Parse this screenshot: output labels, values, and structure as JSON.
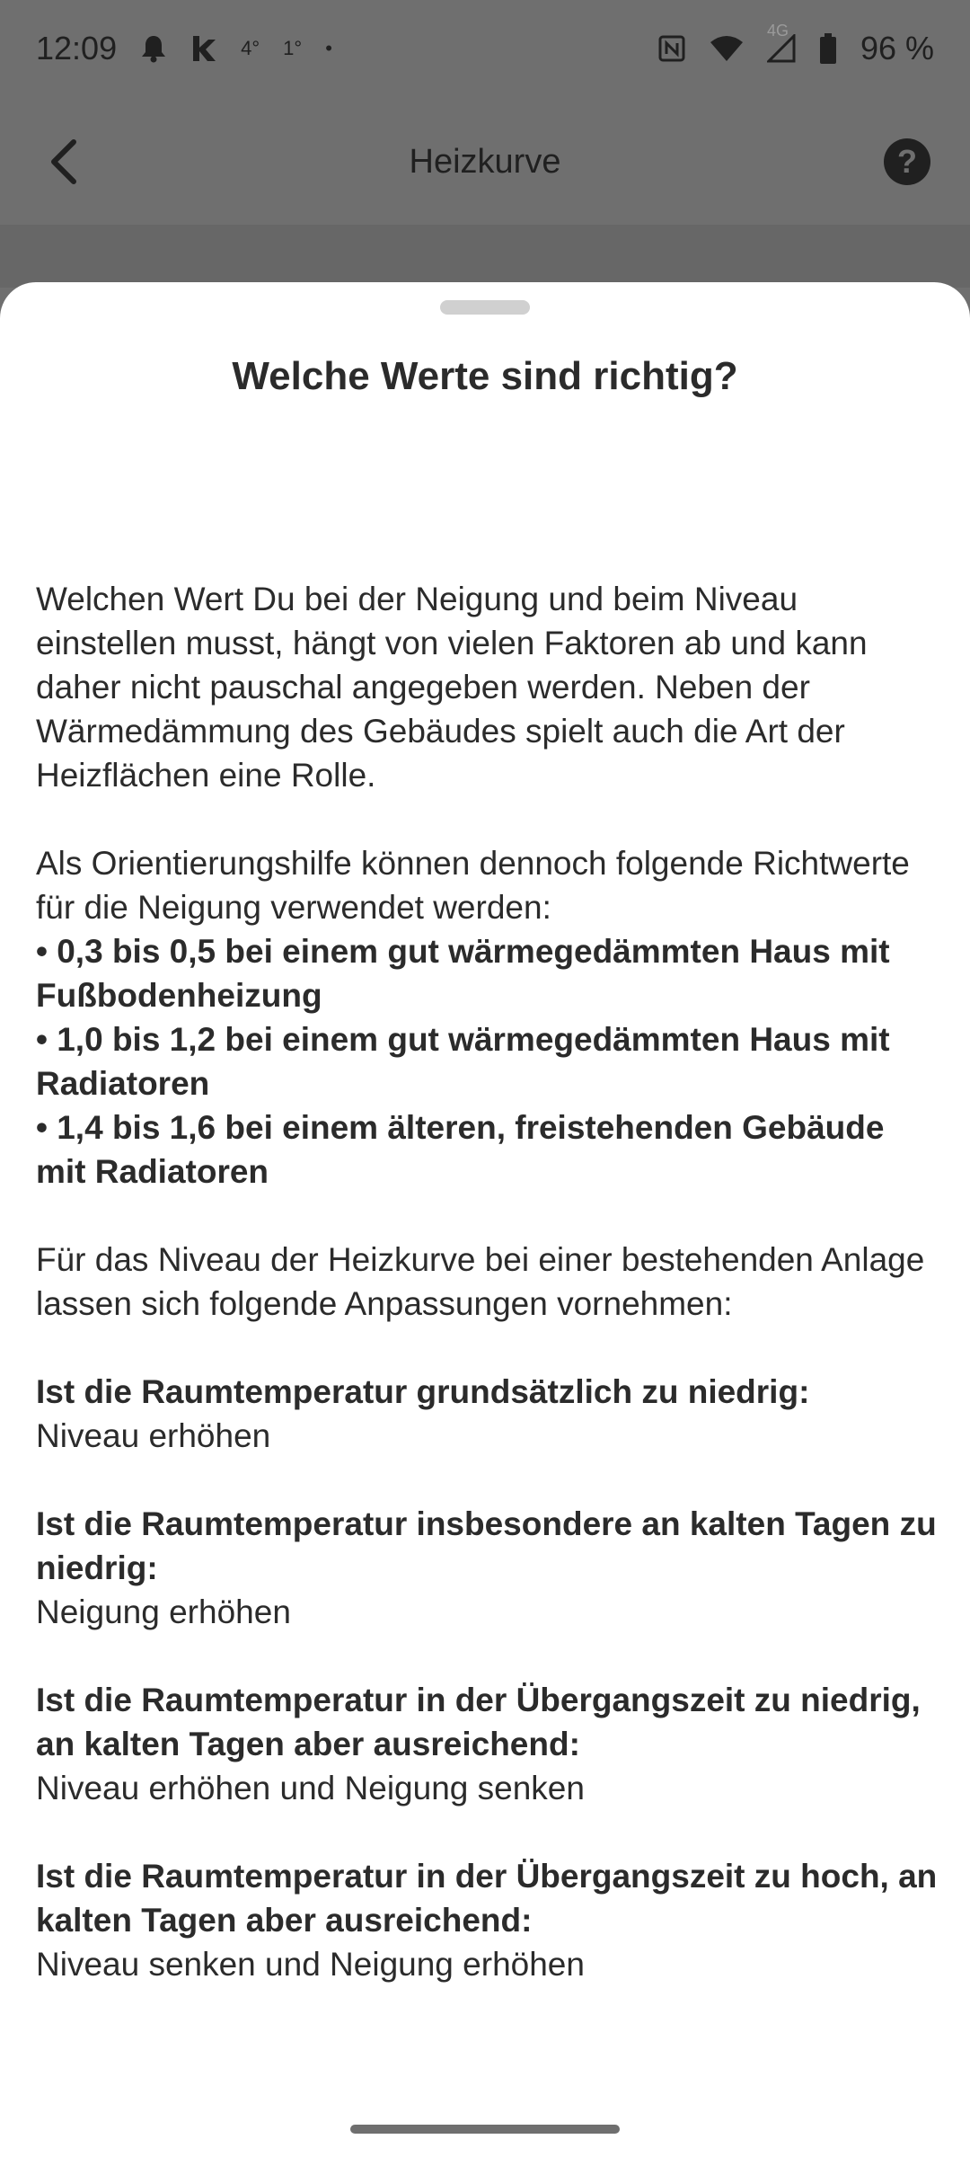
{
  "status_bar": {
    "time": "12:09",
    "temp1": "4°",
    "temp2": "1°",
    "dot": "•",
    "network": "4G",
    "battery": "96 %",
    "icons": [
      "bell-icon",
      "k-app-icon",
      "nfc-icon",
      "wifi-icon",
      "signal-icon",
      "battery-icon"
    ]
  },
  "app_bar": {
    "title": "Heizkurve",
    "back_icon": "chevron-left-icon",
    "help_icon": "help-circle-icon"
  },
  "sheet": {
    "title": "Welche Werte sind richtig?",
    "intro": "Welchen Wert Du bei der Neigung und beim Niveau einstellen musst, hängt von vielen Faktoren ab und kann daher nicht pauschal angegeben werden. Neben der Wärmedämmung des Gebäudes spielt auch die Art der Heizflächen eine Rolle.",
    "guide_intro": "Als Orientierungshilfe können dennoch folgende Richtwerte für die Neigung verwendet werden:",
    "bullets": [
      "• 0,3 bis 0,5 bei einem gut wärmegedämmten Haus mit Fußbodenheizung",
      "• 1,0 bis 1,2 bei einem gut wärmegedämmten Haus mit Radiatoren",
      "• 1,4 bis 1,6 bei einem älteren, freistehenden Gebäude mit Radiatoren"
    ],
    "level_intro": "Für das Niveau der Heizkurve bei einer bestehenden Anlage lassen sich folgende Anpassungen vornehmen:",
    "cases": [
      {
        "question": "Ist die Raumtemperatur grundsätzlich zu niedrig:",
        "answer": "Niveau erhöhen"
      },
      {
        "question": "Ist die Raumtemperatur insbesondere an kalten Tagen zu niedrig:",
        "answer": "Neigung erhöhen"
      },
      {
        "question": "Ist die Raumtemperatur in der Übergangszeit zu niedrig, an kalten Tagen aber ausreichend:",
        "answer": "Niveau erhöhen und Neigung senken"
      },
      {
        "question": "Ist die Raumtemperatur in der Übergangszeit zu hoch, an kalten Tagen aber ausreichend:",
        "answer": "Niveau senken und Neigung erhöhen"
      }
    ]
  }
}
